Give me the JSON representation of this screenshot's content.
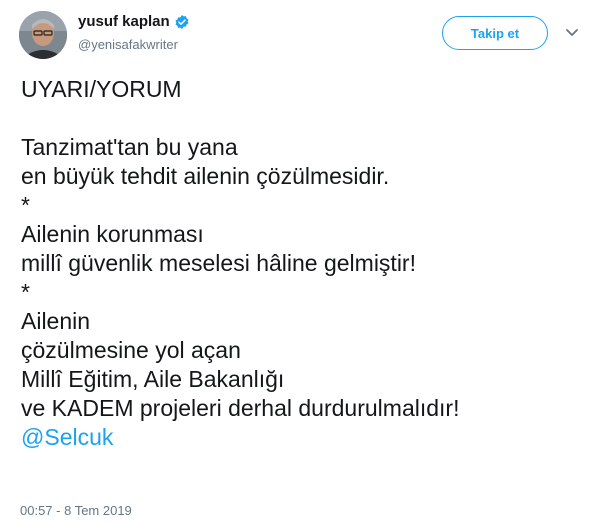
{
  "author": {
    "display_name": "yusuf kaplan",
    "handle": "@yenisafakwriter",
    "verified": true
  },
  "follow_button": {
    "label": "Takip et"
  },
  "tweet": {
    "lines": [
      "UYARI/YORUM",
      "",
      "Tanzimat'tan bu yana",
      "en büyük tehdit ailenin çözülmesidir.",
      "*",
      "Ailenin korunması",
      "millî güvenlik meselesi hâline gelmiştir!",
      "*",
      "Ailenin",
      "çözülmesine yol açan",
      "Millî Eğitim, Aile Bakanlığı",
      "ve KADEM projeleri derhal durdurulmalıdır!"
    ],
    "mention": "@Selcuk",
    "timestamp": "00:57 - 8 Tem 2019"
  },
  "colors": {
    "accent": "#1da1f2",
    "text": "#14171a",
    "muted": "#657786"
  },
  "icons": {
    "verified": "verified-badge-icon",
    "more": "chevron-down-icon"
  }
}
